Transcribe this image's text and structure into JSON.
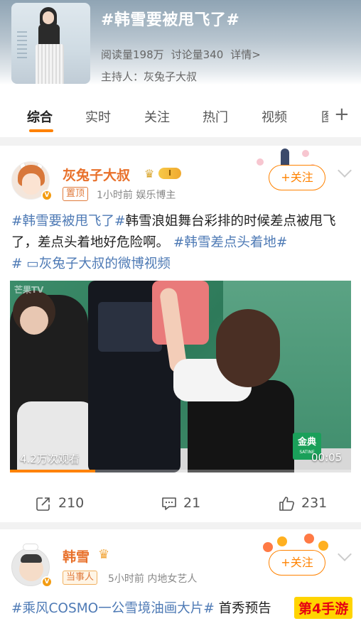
{
  "topic": {
    "title": "#韩雪要被甩飞了#",
    "reads": "阅读量198万",
    "discussions": "讨论量340",
    "detail_link": "详情>",
    "host": "主持人：灰兔子大叔"
  },
  "tabs": {
    "items": [
      "综合",
      "实时",
      "关注",
      "热门",
      "视频"
    ],
    "partial": "图",
    "plus": "+"
  },
  "post1": {
    "username": "灰兔子大叔",
    "level": "I",
    "pin_label": "置顶",
    "time_and_role": "1小时前  娱乐博主",
    "follow_label": "+关注",
    "text": {
      "topic_a": "#韩雪要被甩飞了#",
      "body_a": "韩雪浪姐舞台彩排的时候差点被甩飞了，差点头着地好危险啊。",
      "topic_b": "#韩雪差点头着地#",
      "video_link": " ▭灰兔子大叔的微博视频"
    },
    "video": {
      "logo_text": "芒果TV",
      "views": "4.2万次观看",
      "duration": "00:05",
      "watermark": "金典",
      "watermark_sub": "SATINE",
      "progress": 0.25
    },
    "actions": {
      "reposts": "210",
      "comments": "21",
      "likes": "231"
    }
  },
  "post2": {
    "username": "韩雪",
    "role_label": "当事人",
    "time_and_role": "5小时前  内地女艺人",
    "follow_label": "+关注",
    "text": {
      "topic_a": "#乘风COSMO一公雪境油画大片#",
      "body_a": " 首秀预告"
    }
  },
  "site_watermark": "第4手游",
  "colors": {
    "accent": "#ff8200",
    "topic_link": "#4e7ab5",
    "username": "#e8702a"
  }
}
